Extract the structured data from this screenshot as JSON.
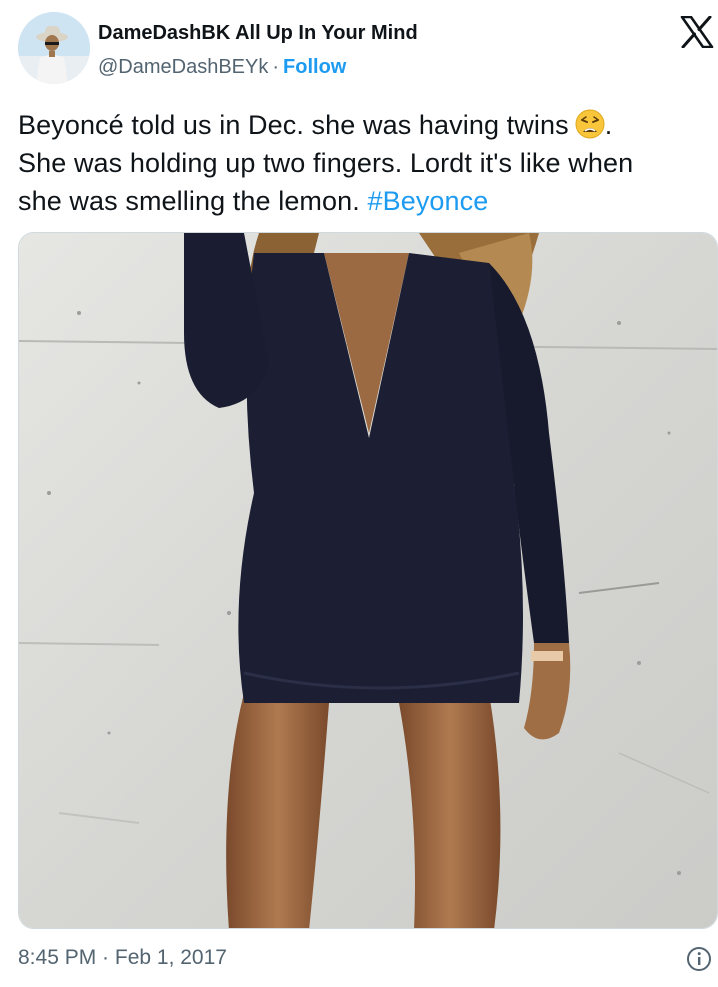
{
  "author": {
    "display_name": "DameDashBK All Up In Your Mind",
    "handle": "@DameDashBEYk",
    "separator": "·",
    "follow_label": "Follow",
    "avatar_icon": "user-avatar"
  },
  "brand": {
    "logo_icon": "x-logo-icon"
  },
  "tweet": {
    "line1": "Beyoncé told us in Dec. she was having twins",
    "line1_end": ".",
    "line2": "She was holding up two fingers. Lordt it's like when",
    "line3_prefix": "she was smelling the lemon.",
    "hashtag": "#Beyonce",
    "emoji_icon": "weary-face-emoji"
  },
  "media": {
    "icon": "photo-woman-navy-dress"
  },
  "footer": {
    "timestamp": "8:45 PM · Feb 1, 2017",
    "info_icon": "info-icon"
  },
  "colors": {
    "accent": "#1d9bf0",
    "text": "#0f1419",
    "muted": "#536471",
    "border": "#cfd9de",
    "dress": "#1c1f33",
    "wall": "#d8d8d5"
  }
}
